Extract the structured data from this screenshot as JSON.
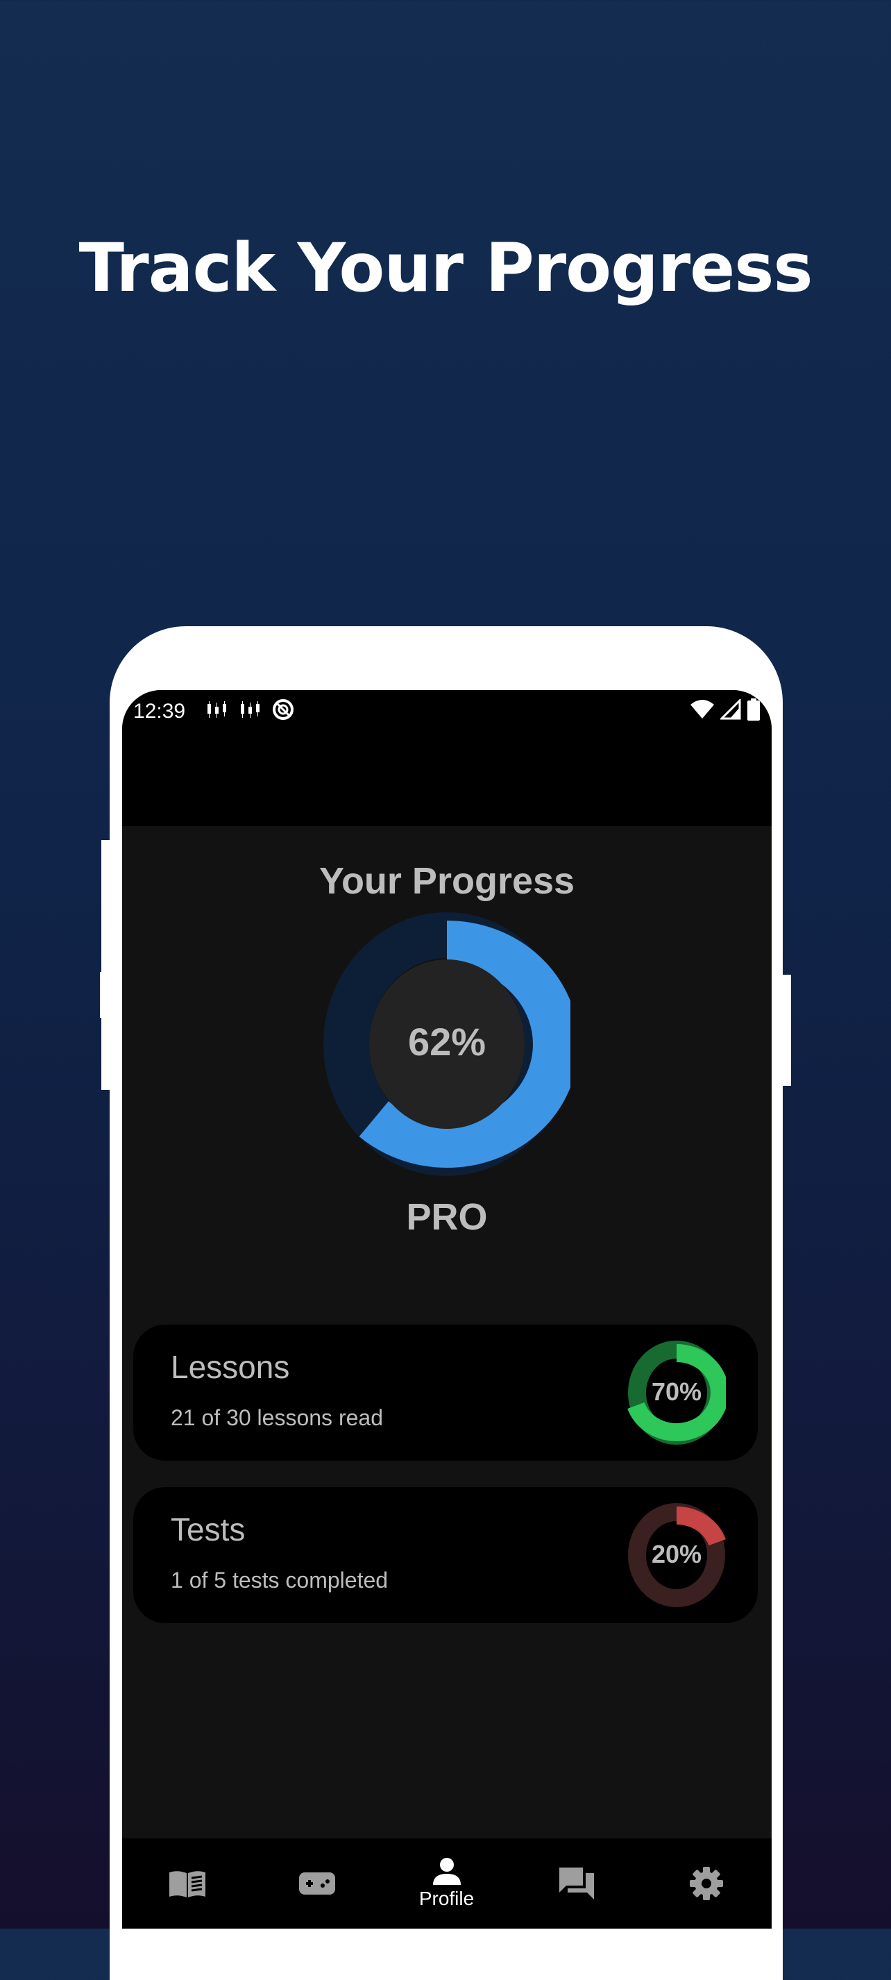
{
  "promo": {
    "headline": "Track Your Progress"
  },
  "status_bar": {
    "time": "12:39"
  },
  "progress": {
    "title": "Your Progress",
    "percent_label": "62%",
    "percent_value": 0.62,
    "level": "PRO",
    "ring_color": "#3d95e6",
    "ring_track_color": "#0d1f36"
  },
  "cards": [
    {
      "title": "Lessons",
      "subtitle": "21 of 30 lessons read",
      "percent_label": "70%",
      "percent_value": 0.7,
      "ring_color": "#2ec85a",
      "ring_track_color": "#176b31"
    },
    {
      "title": "Tests",
      "subtitle": "1 of 5 tests completed",
      "percent_label": "20%",
      "percent_value": 0.2,
      "ring_color": "#c64444",
      "ring_track_color": "#3b2020"
    }
  ],
  "bottom_nav": {
    "items": [
      {
        "icon": "book-icon"
      },
      {
        "icon": "gamepad-icon"
      },
      {
        "icon": "person-icon",
        "label": "Profile",
        "active": true
      },
      {
        "icon": "chat-icon"
      },
      {
        "icon": "gear-icon"
      }
    ]
  }
}
